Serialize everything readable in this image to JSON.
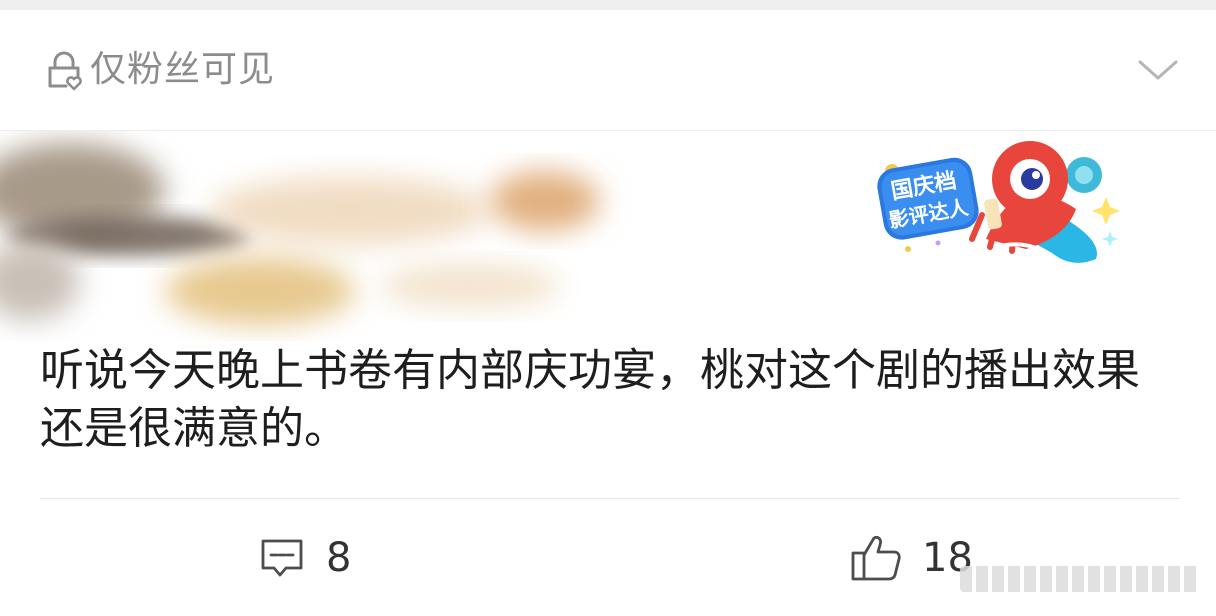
{
  "header": {
    "privacy_label": "仅粉丝可见",
    "privacy_icon": "lock-heart-icon",
    "expand_icon": "chevron-down-icon"
  },
  "badge": {
    "line1": "国庆档",
    "line2": "影评达人",
    "icon": "mascot-badge-icon"
  },
  "post": {
    "text": "听说今天晚上书卷有内部庆功宴，桃对这个剧的播出效果还是很满意的。"
  },
  "actions": {
    "comment_count": "8",
    "comment_icon": "comment-icon",
    "like_count": "18",
    "like_icon": "thumbs-up-icon"
  },
  "colors": {
    "muted_text": "#8c8c8c",
    "body_text": "#1e1e1e",
    "badge_blue": "#2a78e0",
    "mascot_red": "#e8453c"
  }
}
